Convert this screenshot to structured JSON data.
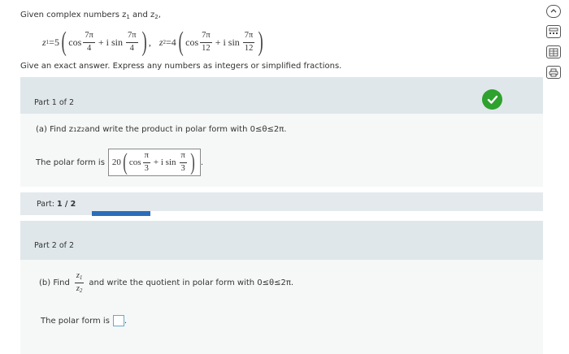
{
  "header": {
    "prompt": "Given complex numbers z",
    "prompt_sub1": "1",
    "prompt_and": " and z",
    "prompt_sub2": "2",
    "prompt_end": ",",
    "z1_label": "z",
    "z1_sub": "1",
    "z1_coef": "=5",
    "z2_label": "z",
    "z2_sub": "2",
    "z2_coef": "=4",
    "cos": "cos",
    "plus_i_sin": "+ i sin",
    "z1_num": "7π",
    "z1_den": "4",
    "z2_num": "7π",
    "z2_den": "12",
    "separator": ",",
    "instructions": "Give an exact answer. Express any numbers as integers or simplified fractions."
  },
  "part1": {
    "label": "Part 1 of 2",
    "question_prefix": "(a) Find z",
    "q_sub1": "1",
    "q_mid": "z",
    "q_sub2": "2",
    "question_suffix": " and write the product in polar form with 0≤θ≤2π.",
    "answer_prefix": "The polar form is",
    "answer_coef": "20",
    "answer_cos": "cos",
    "answer_num": "π",
    "answer_den": "3",
    "answer_plus": "+ i sin",
    "answer_num2": "π",
    "answer_den2": "3",
    "answer_end": "."
  },
  "progress": {
    "label_prefix": "Part: ",
    "label_value": "1 / 2",
    "fraction": 0.5,
    "color": "#2a6ebb"
  },
  "part2": {
    "label": "Part 2 of 2",
    "question_prefix": "(b) Find",
    "frac_num": "z",
    "frac_num_sub": "1",
    "frac_den": "z",
    "frac_den_sub": "2",
    "question_suffix": "and write the quotient in polar form with 0≤θ≤2π.",
    "answer_prefix": "The polar form is",
    "answer_end": "."
  },
  "side_tools": [
    "collapse-icon",
    "calculator-icon",
    "table-icon",
    "print-icon"
  ],
  "colors": {
    "correct": "#2ea12e",
    "part_bar": "#dfe7ea",
    "panel": "#f6f8f8"
  }
}
